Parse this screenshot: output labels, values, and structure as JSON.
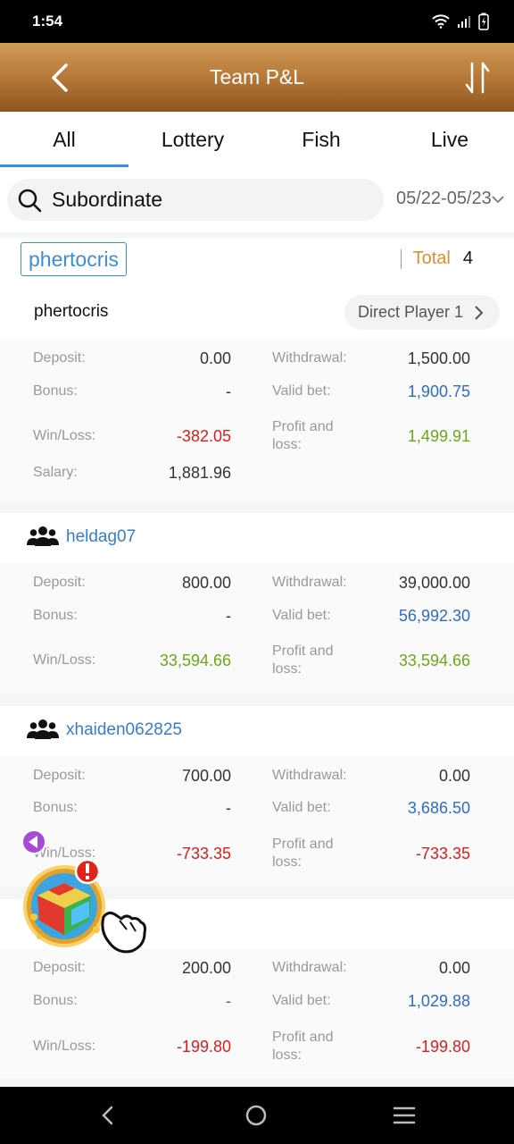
{
  "status": {
    "time": "1:54"
  },
  "header": {
    "title": "Team P&L"
  },
  "tabs": [
    {
      "label": "All",
      "active": true
    },
    {
      "label": "Lottery"
    },
    {
      "label": "Fish"
    },
    {
      "label": "Live"
    }
  ],
  "search": {
    "label": "Subordinate"
  },
  "date_range": "05/22-05/23",
  "selected_user": "phertocris",
  "total": {
    "label": "Total",
    "value": "4"
  },
  "labels": {
    "deposit": "Deposit:",
    "withdrawal": "Withdrawal:",
    "bonus": "Bonus:",
    "valid_bet": "Valid bet:",
    "win_loss": "Win/Loss:",
    "profit_and_loss_1": "Profit and",
    "profit_and_loss_2": "loss:",
    "salary": "Salary:"
  },
  "cards": [
    {
      "name": "phertocris",
      "direct_player": "Direct Player 1",
      "deposit": "0.00",
      "withdrawal": "1,500.00",
      "bonus": "-",
      "valid_bet": "1,900.75",
      "win_loss": "-382.05",
      "profit_loss": "1,499.91",
      "salary": "1,881.96"
    },
    {
      "name": "heldag07",
      "deposit": "800.00",
      "withdrawal": "39,000.00",
      "bonus": "-",
      "valid_bet": "56,992.30",
      "win_loss": "33,594.66",
      "profit_loss": "33,594.66"
    },
    {
      "name": "xhaiden062825",
      "deposit": "700.00",
      "withdrawal": "0.00",
      "bonus": "-",
      "valid_bet": "3,686.50",
      "win_loss": "-733.35",
      "profit_loss": "-733.35"
    },
    {
      "name": "",
      "deposit": "200.00",
      "withdrawal": "0.00",
      "bonus": "-",
      "valid_bet": "1,029.88",
      "win_loss": "-199.80",
      "profit_loss": "-199.80"
    }
  ],
  "colors": {
    "header_gradient_top": "#d09a55",
    "header_gradient_bottom": "#8e561f",
    "accent_blue": "#3a8fd6",
    "total_orange": "#e08e2a",
    "loss_red": "#d81e1e",
    "profit_green": "#6ea61a",
    "bet_blue": "#2e6cc9"
  },
  "icons": {
    "back": "back-arrow-icon",
    "sort": "sort-arrows-icon",
    "search": "search-icon",
    "date_dropdown": "chevron-down-icon",
    "pill_chevron": "chevron-right-icon",
    "group": "group-users-icon",
    "float_button": "gift-box-icon",
    "nav_back": "nav-back-icon",
    "nav_home": "nav-home-icon",
    "nav_menu": "nav-menu-icon"
  }
}
